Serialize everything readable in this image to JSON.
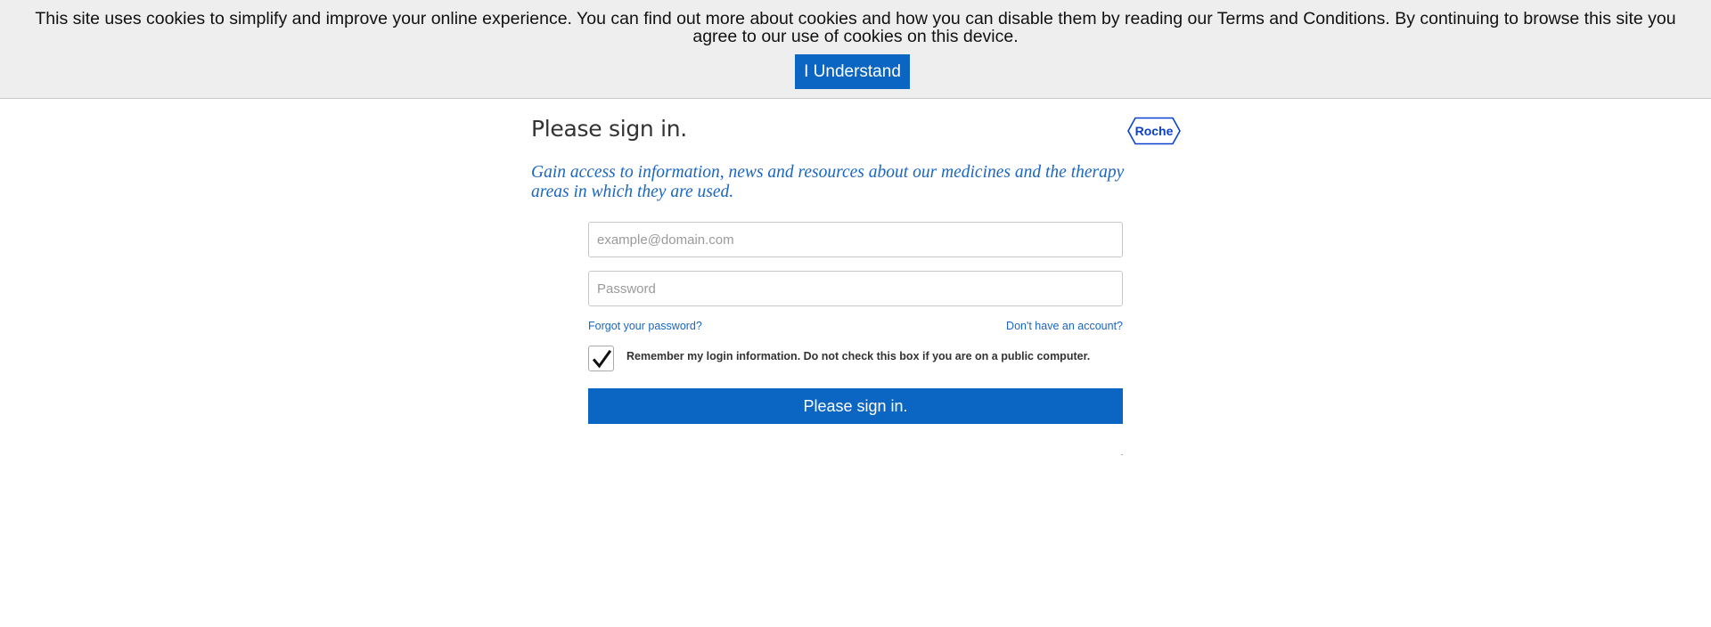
{
  "cookie_banner": {
    "text": "This site uses cookies to simplify and improve your online experience. You can find out more about cookies and how you can disable them by reading our Terms and Conditions. By continuing to browse this site you agree to our use of cookies on this device.",
    "button_label": "I Understand"
  },
  "header": {
    "title": "Please sign in.",
    "logo_text": "Roche",
    "tagline": "Gain access to information, news and resources about our medicines and the therapy areas in which they are used."
  },
  "form": {
    "email_placeholder": "example@domain.com",
    "email_value": "",
    "password_placeholder": "Password",
    "password_value": "",
    "forgot_link": "Forgot your password?",
    "signup_link": "Don't have an account?",
    "remember_checked": true,
    "remember_label": "Remember my login information. Do not check this box if you are on a public computer.",
    "submit_label": "Please sign in."
  },
  "colors": {
    "accent": "#0b66c3",
    "link": "#1a66c2",
    "logo": "#0b41cd",
    "banner_bg": "#eeeeee"
  },
  "icons": {
    "remember_checkbox": "checkmark-icon",
    "logo": "roche-hexagon-logo"
  }
}
